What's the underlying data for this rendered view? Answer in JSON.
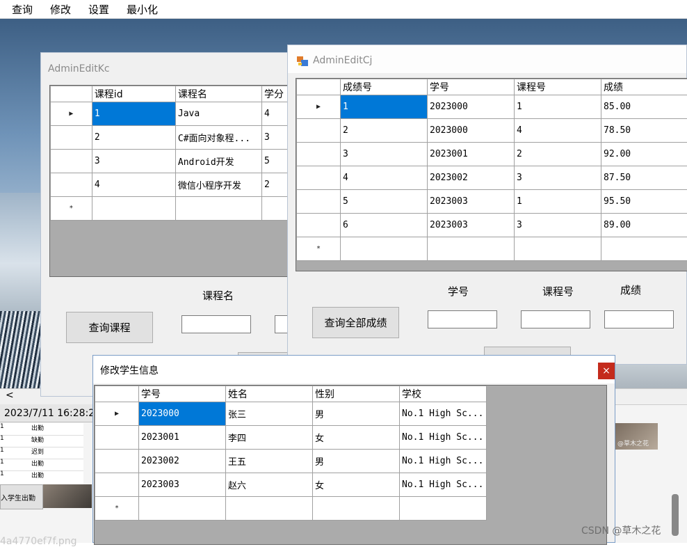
{
  "menu": [
    "查询",
    "修改",
    "设置",
    "最小化"
  ],
  "kc": {
    "title": "AdminEditKc",
    "columns": [
      "课程id",
      "课程名",
      "学分"
    ],
    "rows": [
      [
        "1",
        "Java",
        "4"
      ],
      [
        "2",
        "C#面向对象程...",
        "3"
      ],
      [
        "3",
        "Android开发",
        "5"
      ],
      [
        "4",
        "微信小程序开发",
        "2"
      ]
    ],
    "new_row_marker": "*",
    "current_row_marker": "▶",
    "field_label": "课程名",
    "query_button": "查询课程"
  },
  "cj": {
    "title": "AdminEditCj",
    "columns": [
      "成绩号",
      "学号",
      "课程号",
      "成绩"
    ],
    "rows": [
      [
        "1",
        "2023000",
        "1",
        "85.00"
      ],
      [
        "2",
        "2023000",
        "4",
        "78.50"
      ],
      [
        "3",
        "2023001",
        "2",
        "92.00"
      ],
      [
        "4",
        "2023002",
        "3",
        "87.50"
      ],
      [
        "5",
        "2023003",
        "1",
        "95.50"
      ],
      [
        "6",
        "2023003",
        "3",
        "89.00"
      ]
    ],
    "labels": [
      "学号",
      "课程号",
      "成绩"
    ],
    "query_button": "查询全部成绩"
  },
  "stu": {
    "title": "修改学生信息",
    "close": "×",
    "columns": [
      "学号",
      "姓名",
      "性别",
      "学校"
    ],
    "rows": [
      [
        "2023000",
        "张三",
        "男",
        "No.1 High Sc..."
      ],
      [
        "2023001",
        "李四",
        "女",
        "No.1 High Sc..."
      ],
      [
        "2023002",
        "王五",
        "男",
        "No.1 High Sc..."
      ],
      [
        "2023003",
        "赵六",
        "女",
        "No.1 High Sc..."
      ]
    ]
  },
  "background": {
    "scroll_left": "<",
    "timestamp": "2023/7/11 16:28:2",
    "attendance": [
      [
        "1",
        "出勤"
      ],
      [
        "1",
        "缺勤"
      ],
      [
        "1",
        "迟到"
      ],
      [
        "1",
        "出勤"
      ],
      [
        "1",
        "出勤"
      ]
    ],
    "button": "入学生出勤",
    "filename": "4a4770ef7f.png",
    "thumb_caption": "@草木之花"
  },
  "watermark": "CSDN @草木之花"
}
